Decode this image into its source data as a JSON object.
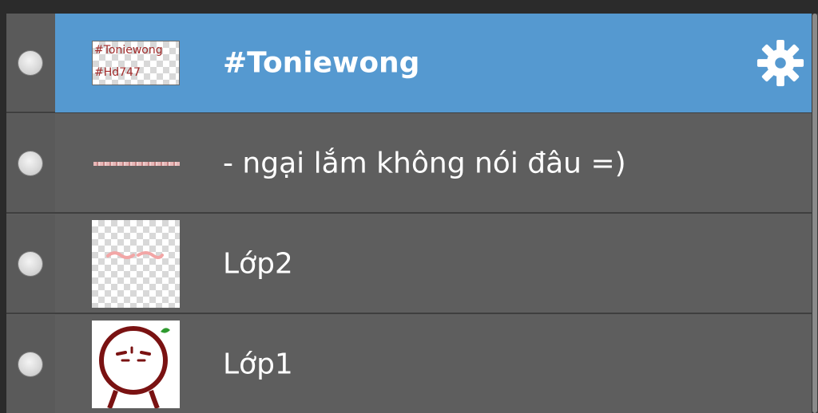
{
  "layers": [
    {
      "name": "#Toniewong",
      "selected": true,
      "visible": true,
      "thumbnail_text": [
        "#Toniewong",
        "#Hd747"
      ],
      "settings_icon": "gear-icon"
    },
    {
      "name": "- ngại lắm không nói đâu =)",
      "selected": false,
      "visible": true
    },
    {
      "name": "Lớp2",
      "selected": false,
      "visible": true
    },
    {
      "name": "Lớp1",
      "selected": false,
      "visible": true
    }
  ],
  "colors": {
    "selected_row": "#5599d0",
    "row_background": "#5e5e5e",
    "text": "#ffffff",
    "thumbnail_text": "#a12a2a"
  }
}
